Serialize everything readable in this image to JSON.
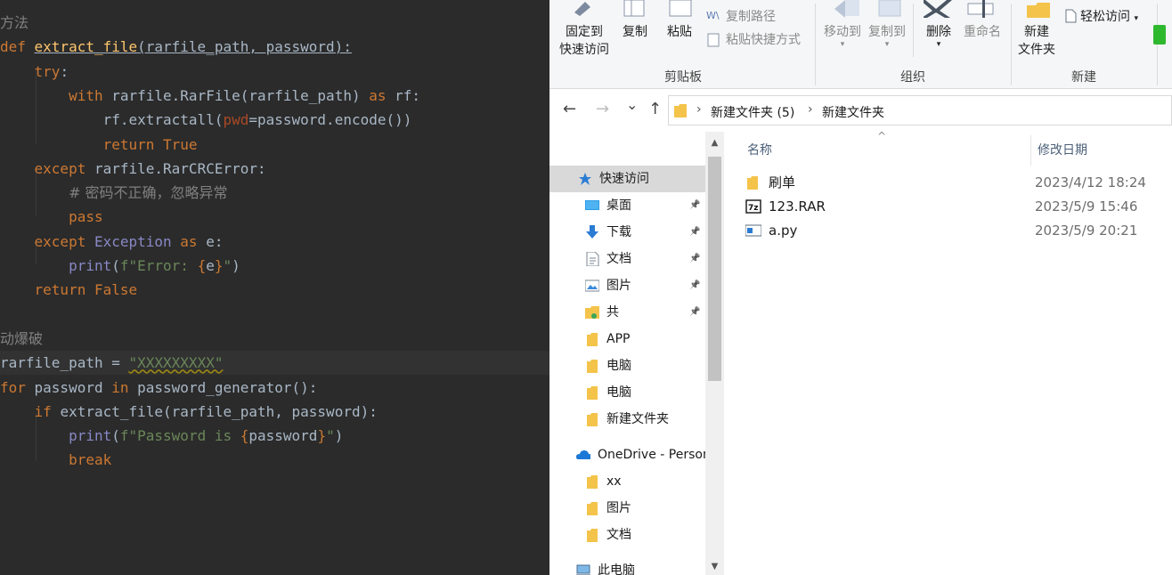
{
  "editor": {
    "lines": [
      {
        "segs": [
          {
            "c": "cm cjk",
            "t": "方法"
          }
        ]
      },
      {
        "segs": [
          {
            "c": "kw",
            "t": "def "
          },
          {
            "c": "fn ul",
            "t": "extract_file"
          },
          {
            "c": "ul",
            "t": "(rarfile_path, password):"
          }
        ]
      },
      {
        "segs": [
          {
            "c": "kw",
            "t": "    try"
          },
          {
            "c": "",
            "t": ":"
          }
        ]
      },
      {
        "segs": [
          {
            "c": "",
            "t": "        "
          },
          {
            "c": "kw",
            "t": "with "
          },
          {
            "c": "",
            "t": "rarfile.RarFile(rarfile_path) "
          },
          {
            "c": "kw",
            "t": "as "
          },
          {
            "c": "",
            "t": "rf:"
          }
        ]
      },
      {
        "segs": [
          {
            "c": "",
            "t": "            rf.extractall("
          },
          {
            "c": "kwarg",
            "t": "pwd"
          },
          {
            "c": "",
            "t": "=password.encode())"
          }
        ]
      },
      {
        "segs": [
          {
            "c": "",
            "t": "            "
          },
          {
            "c": "kw",
            "t": "return True"
          }
        ]
      },
      {
        "segs": [
          {
            "c": "kw",
            "t": "    except "
          },
          {
            "c": "",
            "t": "rarfile.RarCRCError:"
          }
        ]
      },
      {
        "segs": [
          {
            "c": "",
            "t": "        "
          },
          {
            "c": "cm cjk",
            "t": "# 密码不正确，忽略异常"
          }
        ]
      },
      {
        "segs": [
          {
            "c": "",
            "t": "        "
          },
          {
            "c": "kw",
            "t": "pass"
          }
        ]
      },
      {
        "segs": [
          {
            "c": "kw",
            "t": "    except "
          },
          {
            "c": "cls",
            "t": "Exception "
          },
          {
            "c": "kw",
            "t": "as "
          },
          {
            "c": "",
            "t": "e:"
          }
        ]
      },
      {
        "segs": [
          {
            "c": "",
            "t": "        "
          },
          {
            "c": "bi",
            "t": "print"
          },
          {
            "c": "",
            "t": "("
          },
          {
            "c": "str",
            "t": "f\"Error: "
          },
          {
            "c": "brace",
            "t": "{"
          },
          {
            "c": "",
            "t": "e"
          },
          {
            "c": "brace",
            "t": "}"
          },
          {
            "c": "str",
            "t": "\""
          },
          {
            "c": "",
            "t": ")"
          }
        ]
      },
      {
        "segs": [
          {
            "c": "kw",
            "t": "    return False"
          }
        ]
      },
      {
        "segs": []
      },
      {
        "segs": [
          {
            "c": "cm cjk",
            "t": "动爆破"
          }
        ]
      },
      {
        "segs": [
          {
            "c": "",
            "t": "rarfile_path = "
          },
          {
            "c": "str wavy",
            "t": "\"XXXXXXXXX\""
          }
        ],
        "current": true
      },
      {
        "segs": [
          {
            "c": "kw",
            "t": "for "
          },
          {
            "c": "",
            "t": "password "
          },
          {
            "c": "kw",
            "t": "in "
          },
          {
            "c": "",
            "t": "password_generator():"
          }
        ]
      },
      {
        "segs": [
          {
            "c": "kw",
            "t": "    if "
          },
          {
            "c": "",
            "t": "extract_file(rarfile_path, password):"
          }
        ]
      },
      {
        "segs": [
          {
            "c": "",
            "t": "        "
          },
          {
            "c": "bi",
            "t": "print"
          },
          {
            "c": "",
            "t": "("
          },
          {
            "c": "str",
            "t": "f\"Password is "
          },
          {
            "c": "brace",
            "t": "{"
          },
          {
            "c": "",
            "t": "password"
          },
          {
            "c": "brace",
            "t": "}"
          },
          {
            "c": "str",
            "t": "\""
          },
          {
            "c": "",
            "t": ")"
          }
        ]
      },
      {
        "segs": [
          {
            "c": "",
            "t": "        "
          },
          {
            "c": "kw",
            "t": "break"
          }
        ]
      }
    ]
  },
  "ribbon": {
    "pin_label_1": "固定到",
    "pin_label_2": "快速访问",
    "copy": "复制",
    "paste": "粘贴",
    "copy_path": "复制路径",
    "paste_shortcut": "粘贴快捷方式",
    "move_to": "移动到",
    "copy_to": "复制到",
    "delete": "删除",
    "rename": "重命名",
    "new_folder_1": "新建",
    "new_folder_2": "文件夹",
    "easy_access": "轻松访问",
    "group_clipboard": "剪贴板",
    "group_organize": "组织",
    "group_new": "新建"
  },
  "address": {
    "back": "←",
    "forward": "→",
    "recent": "⌄",
    "up": "↑",
    "crumb1": "新建文件夹 (5)",
    "crumb2": "新建文件夹"
  },
  "nav": {
    "items": [
      {
        "label": "快速访问",
        "icon": "star-icon",
        "sel": true,
        "pin": false
      },
      {
        "label": "桌面",
        "icon": "desktop-icon",
        "pin": true
      },
      {
        "label": "下载",
        "icon": "download-icon",
        "pin": true
      },
      {
        "label": "文档",
        "icon": "document-icon",
        "pin": true
      },
      {
        "label": "图片",
        "icon": "picture-icon",
        "pin": true
      },
      {
        "label": "共",
        "icon": "shared-folder-icon",
        "pin": true
      },
      {
        "label": "APP",
        "icon": "folder-icon"
      },
      {
        "label": "电脑",
        "icon": "folder-icon"
      },
      {
        "label": "电脑",
        "icon": "folder-icon"
      },
      {
        "label": "新建文件夹",
        "icon": "folder-icon"
      },
      {
        "label": "OneDrive - Personal",
        "icon": "onedrive-icon"
      },
      {
        "label": "xx",
        "icon": "folder-icon"
      },
      {
        "label": "图片",
        "icon": "folder-icon"
      },
      {
        "label": "文档",
        "icon": "folder-icon"
      },
      {
        "label": "此电脑",
        "icon": "computer-icon"
      }
    ]
  },
  "file_list": {
    "col_name": "名称",
    "col_date": "修改日期",
    "files": [
      {
        "name": "刷单",
        "date": "2023/4/12 18:24",
        "icon": "folder-icon"
      },
      {
        "name": "123.RAR",
        "date": "2023/5/9 15:46",
        "icon": "7z-archive-icon"
      },
      {
        "name": "a.py",
        "date": "2023/5/9 20:21",
        "icon": "python-file-icon"
      }
    ]
  },
  "colors": {
    "editor_bg": "#2b2b2b",
    "keyword": "#cc7832",
    "function": "#ffc66d",
    "string": "#6a8759",
    "comment": "#808080",
    "folder": "#f4c34a",
    "accent_blue": "#2b7cd3"
  }
}
